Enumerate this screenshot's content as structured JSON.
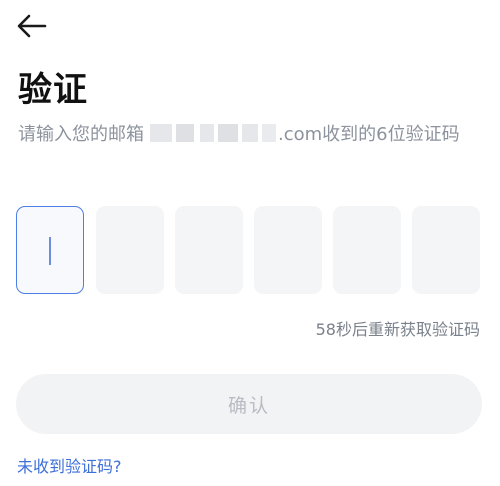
{
  "header": {
    "back_icon": "arrow-left-icon"
  },
  "page": {
    "title": "验证",
    "subtitle_prefix": "请输入您的邮箱",
    "subtitle_suffix": ".com收到的6位验证码"
  },
  "code_input": {
    "length": 6,
    "values": [
      "",
      "",
      "",
      "",
      "",
      ""
    ],
    "active_index": 0
  },
  "resend": {
    "label": "58秒后重新获取验证码"
  },
  "confirm": {
    "label": "确认"
  },
  "help": {
    "label": "未收到验证码?"
  },
  "colors": {
    "accent": "#4d7fe6",
    "link": "#3d6fd8",
    "muted_text": "#8c939d",
    "box_bg": "#f4f5f7",
    "button_disabled_bg": "#f2f3f5",
    "button_disabled_text": "#b8bcc2"
  }
}
